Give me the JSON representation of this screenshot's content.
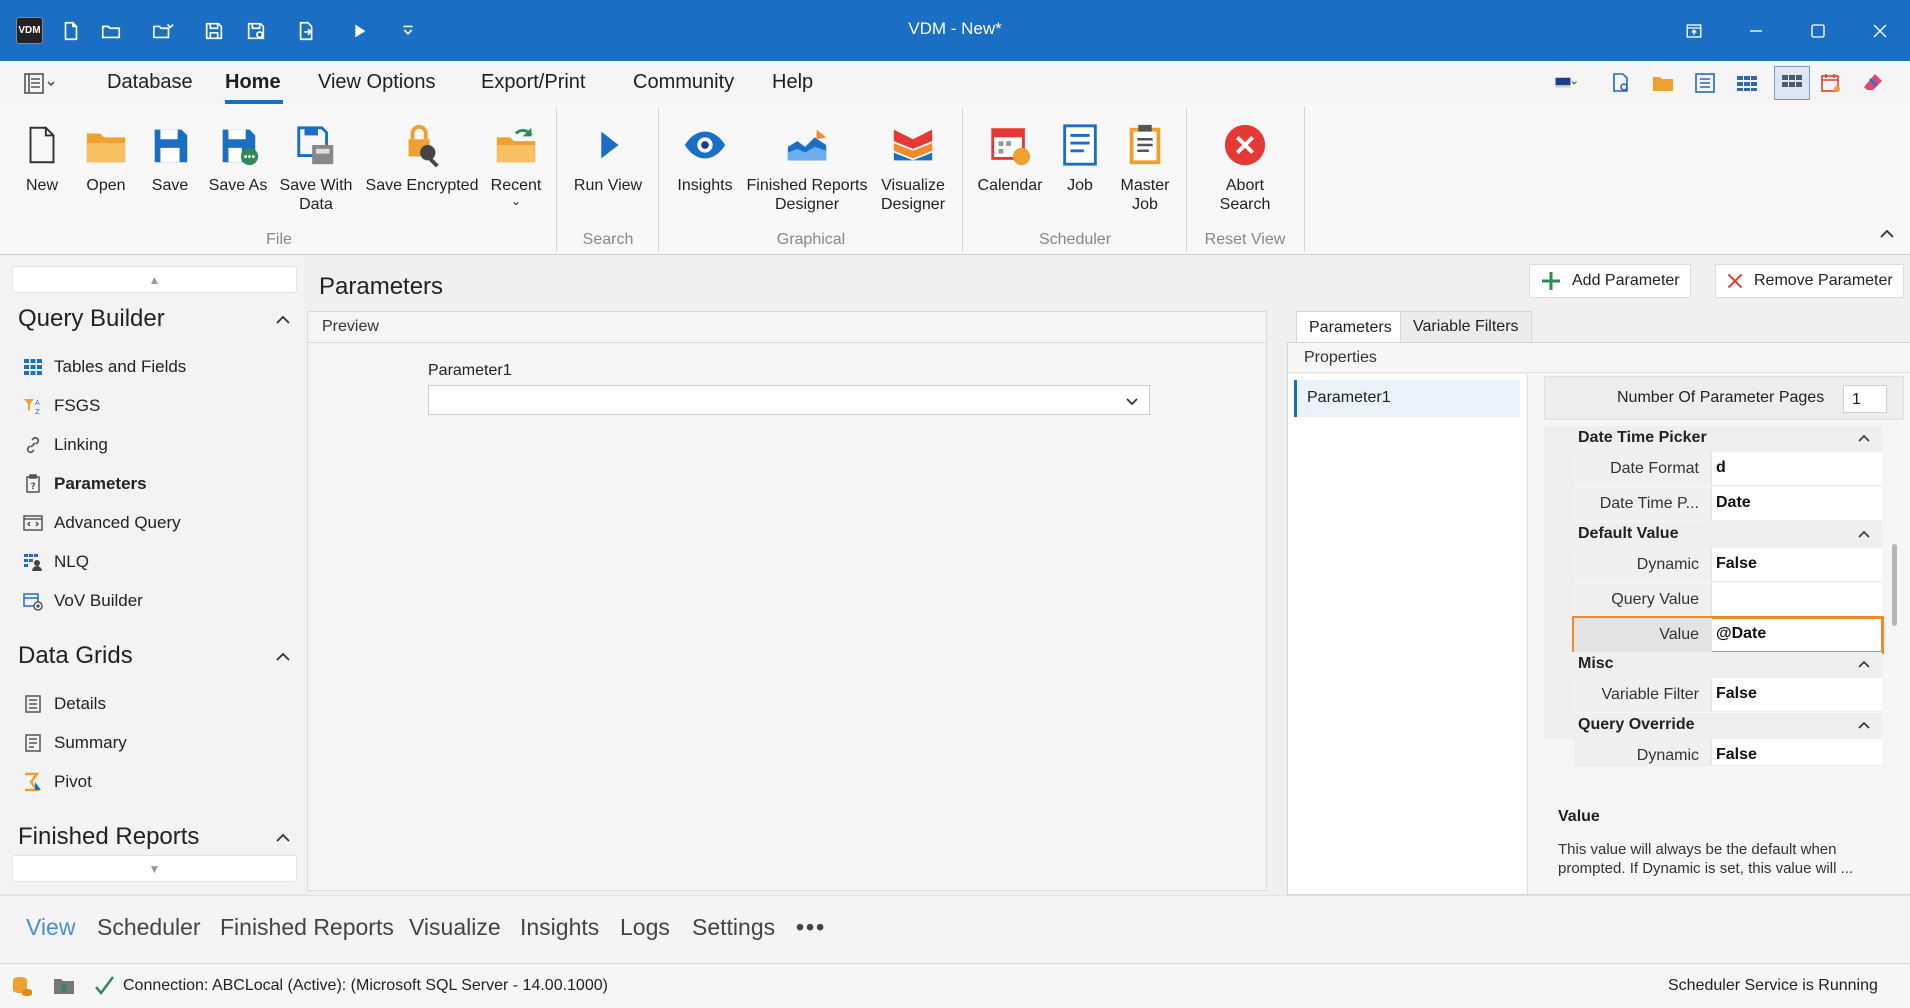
{
  "window": {
    "title": "VDM - New*",
    "logo_text": "VDM"
  },
  "menu": {
    "tabs": [
      "Database",
      "Home",
      "View Options",
      "Export/Print",
      "Community",
      "Help"
    ],
    "active": "Home"
  },
  "ribbon": {
    "buttons": {
      "new": "New",
      "open": "Open",
      "save": "Save",
      "save_as": "Save As",
      "save_with_data_1": "Save With",
      "save_with_data_2": "Data",
      "save_encrypted": "Save Encrypted",
      "recent": "Recent",
      "run_view": "Run View",
      "insights": "Insights",
      "finished_reports_1": "Finished Reports",
      "finished_reports_2": "Designer",
      "visualize_1": "Visualize",
      "visualize_2": "Designer",
      "calendar": "Calendar",
      "job": "Job",
      "master_job_1": "Master",
      "master_job_2": "Job",
      "abort_1": "Abort",
      "abort_2": "Search"
    },
    "groups": {
      "file": "File",
      "search": "Search",
      "graphical": "Graphical",
      "scheduler": "Scheduler",
      "reset_view": "Reset View"
    }
  },
  "sidebar": {
    "query_builder": {
      "title": "Query Builder",
      "items": [
        "Tables and Fields",
        "FSGS",
        "Linking",
        "Parameters",
        "Advanced Query",
        "NLQ",
        "VoV Builder"
      ],
      "active": "Parameters"
    },
    "data_grids": {
      "title": "Data Grids",
      "items": [
        "Details",
        "Summary",
        "Pivot"
      ]
    },
    "finished_reports": {
      "title": "Finished Reports"
    }
  },
  "main": {
    "title": "Parameters",
    "add_parameter": "Add Parameter",
    "remove_parameter": "Remove Parameter",
    "preview": {
      "header": "Preview",
      "param_label": "Parameter1",
      "param_value": ""
    },
    "tabs": {
      "parameters": "Parameters",
      "variable_filters": "Variable Filters"
    },
    "properties": {
      "header": "Properties",
      "list": [
        "Parameter1"
      ],
      "num_pages_label": "Number Of Parameter Pages",
      "num_pages_value": "1",
      "categories": {
        "date_time_picker": "Date Time Picker",
        "default_value": "Default Value",
        "misc": "Misc",
        "query_override": "Query Override"
      },
      "rows": {
        "date_format": {
          "k": "Date Format",
          "v": "d"
        },
        "date_time_p": {
          "k": "Date Time P...",
          "v": "Date"
        },
        "dynamic": {
          "k": "Dynamic",
          "v": "False"
        },
        "query_value": {
          "k": "Query Value",
          "v": ""
        },
        "value": {
          "k": "Value",
          "v": "@Date"
        },
        "variable_filter": {
          "k": "Variable Filter",
          "v": "False"
        },
        "qo_dynamic": {
          "k": "Dynamic",
          "v": "False"
        }
      },
      "description": {
        "title": "Value",
        "text": "This value will always be the default when prompted.  If Dynamic is set, this value will ..."
      }
    }
  },
  "bottom_tabs": [
    "View",
    "Scheduler",
    "Finished Reports",
    "Visualize",
    "Insights",
    "Logs",
    "Settings"
  ],
  "bottom_more": "•••",
  "status": {
    "connection": "Connection: ABCLocal (Active): (Microsoft SQL Server - 14.00.1000)",
    "scheduler": "Scheduler Service is Running"
  },
  "colors": {
    "title_bar": "#1a6fc4",
    "accent": "#1a6fc4",
    "highlight": "#f28a2a",
    "abort": "#e53935"
  }
}
